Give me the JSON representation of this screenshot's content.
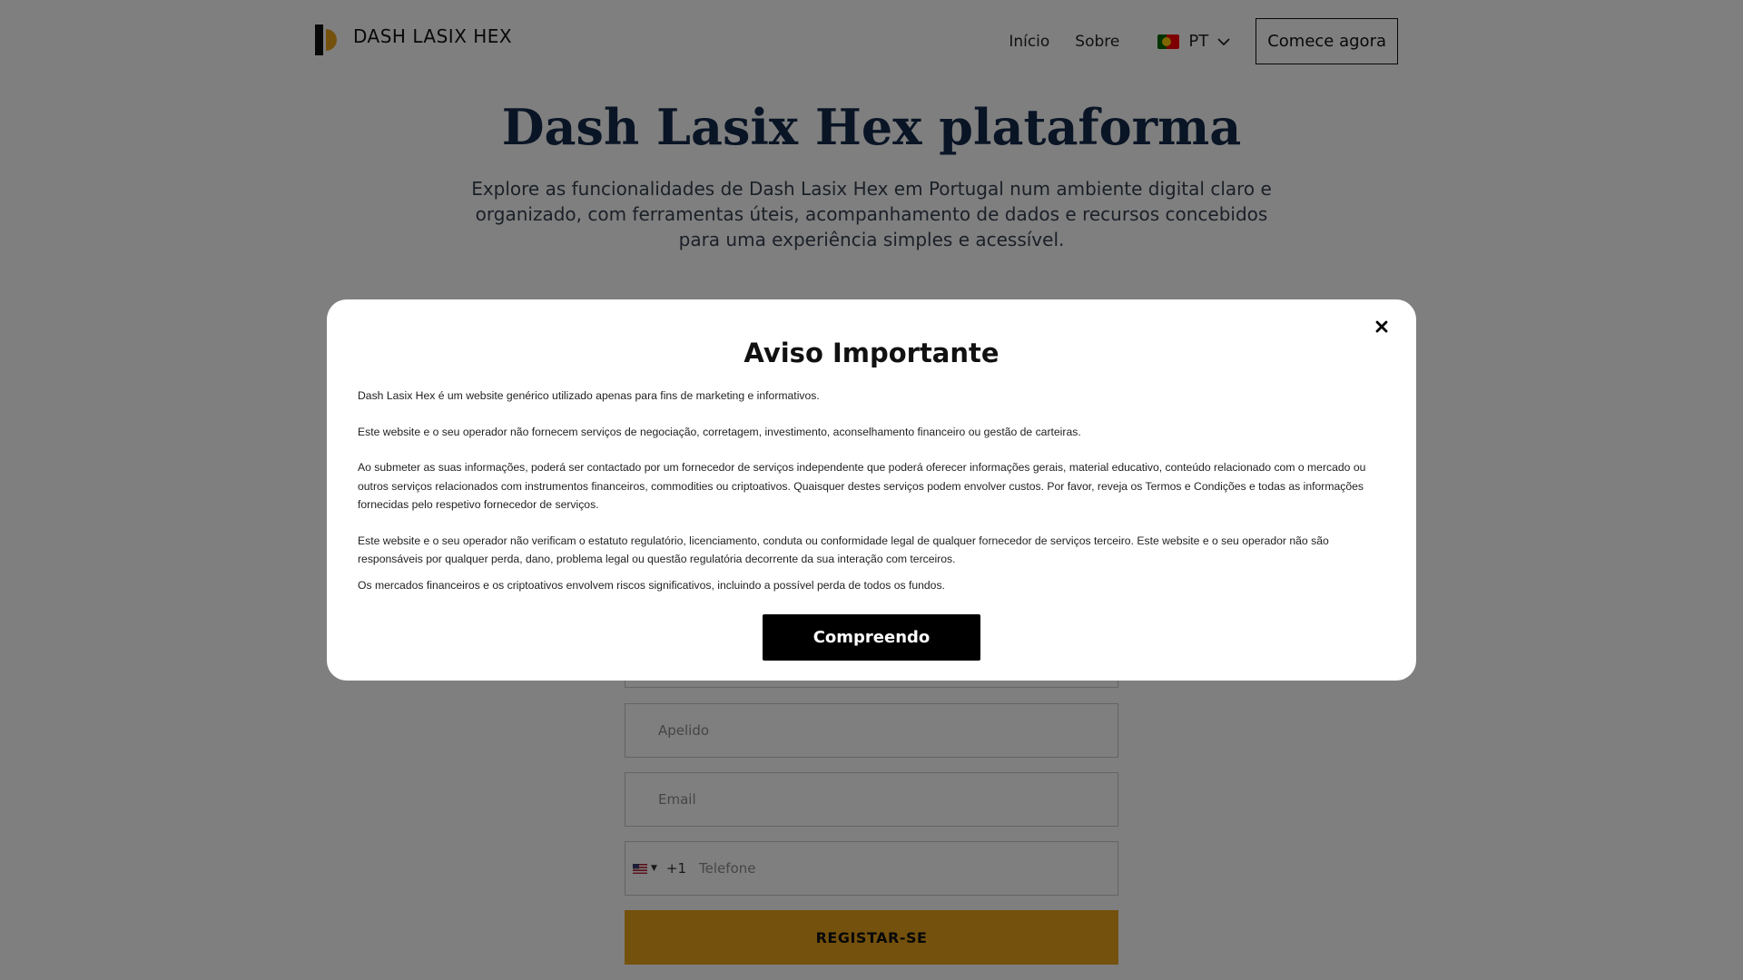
{
  "brand": {
    "name": "DASH LASIX HEX"
  },
  "nav": {
    "items": [
      "Início",
      "Sobre"
    ],
    "language": "PT",
    "cta_label": "Comece agora"
  },
  "hero": {
    "title": "Dash Lasix Hex plataforma",
    "subtitle": "Explore as funcionalidades de Dash Lasix Hex em Portugal num ambiente digital claro e organizado, com ferramentas úteis, acompanhamento de dados e recursos concebidos para uma experiência simples e acessível."
  },
  "form": {
    "lastname_placeholder": "Apelido",
    "email_placeholder": "Email",
    "phone_code": "+1",
    "phone_placeholder": "Telefone",
    "submit_label": "REGISTAR-SE"
  },
  "modal": {
    "title": "Aviso Importante",
    "paragraphs": [
      "Dash Lasix Hex é um website genérico utilizado apenas para fins de marketing e informativos.",
      "Este website e o seu operador não fornecem serviços de negociação, corretagem, investimento, aconselhamento financeiro ou gestão de carteiras.",
      "Ao submeter as suas informações, poderá ser contactado por um fornecedor de serviços independente que poderá oferecer informações gerais, material educativo, conteúdo relacionado com o mercado ou outros serviços relacionados com instrumentos financeiros, commodities ou criptoativos. Quaisquer destes serviços podem envolver custos. Por favor, reveja os Termos e Condições e todas as informações fornecidas pelo respetivo fornecedor de serviços.",
      "Este website e o seu operador não verificam o estatuto regulatório, licenciamento, conduta ou conformidade legal de qualquer fornecedor de serviços terceiro. Este website e o seu operador não são responsáveis por qualquer perda, dano, problema legal ou questão regulatória decorrente da sua interação com terceiros.",
      "Os mercados financeiros e os criptoativos envolvem riscos significativos, incluindo a possível perda de todos os fundos."
    ],
    "confirm_label": "Compreendo"
  },
  "colors": {
    "accent": "#e8a21a",
    "title": "#13294b",
    "overlay": "rgba(0,0,0,0.5)"
  },
  "icons": {
    "logo": "half-circle-logo-icon",
    "language_flag": "portugal-flag-icon",
    "language_chevron": "chevron-down-icon",
    "phone_flag": "us-flag-icon",
    "close": "close-icon"
  }
}
